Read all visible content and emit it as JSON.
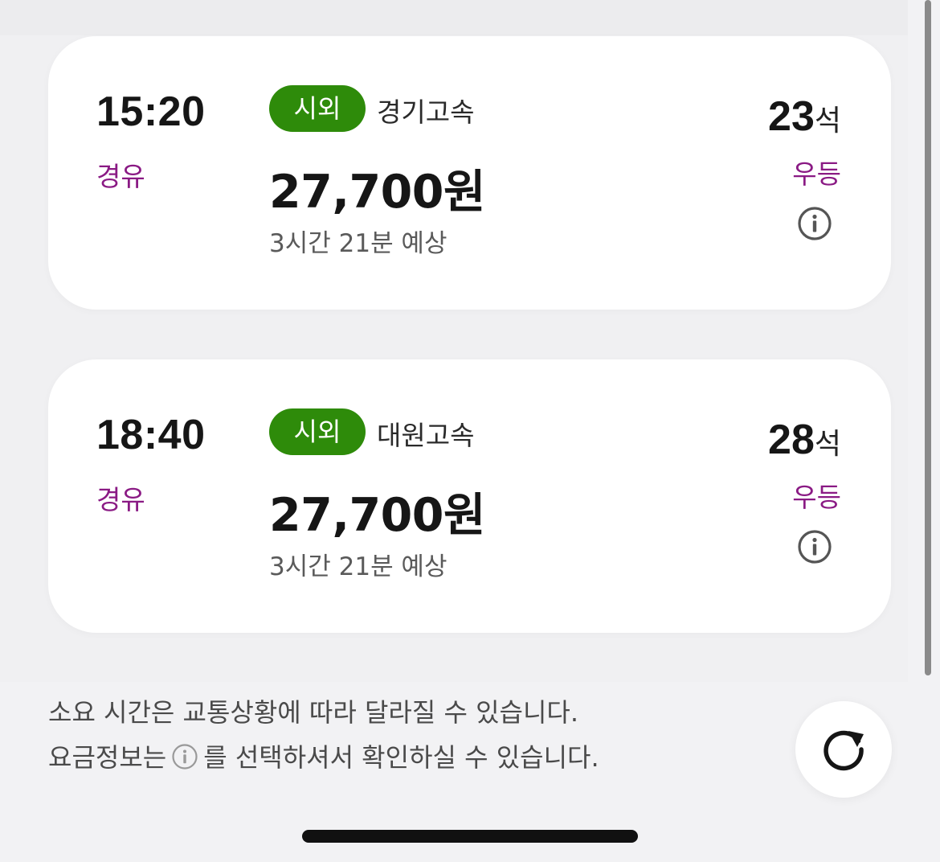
{
  "buses": [
    {
      "time": "15:20",
      "route_type": "경유",
      "badge": "시외",
      "company": "경기고속",
      "price": "27,700원",
      "duration": "3시간 21분 예상",
      "seats": "23",
      "seat_unit": "석",
      "grade": "우등"
    },
    {
      "time": "18:40",
      "route_type": "경유",
      "badge": "시외",
      "company": "대원고속",
      "price": "27,700원",
      "duration": "3시간 21분 예상",
      "seats": "28",
      "seat_unit": "석",
      "grade": "우등"
    }
  ],
  "notice": {
    "line1": "소요 시간은 교통상황에 따라 달라질 수 있습니다.",
    "line2_before": "요금정보는",
    "line2_after": "를 선택하셔서 확인하실 수 있습니다."
  },
  "icons": {
    "info": "info-circle-icon",
    "refresh": "refresh-icon"
  },
  "colors": {
    "badge_green": "#2e8b0a",
    "route_purple": "#8a1a84"
  }
}
